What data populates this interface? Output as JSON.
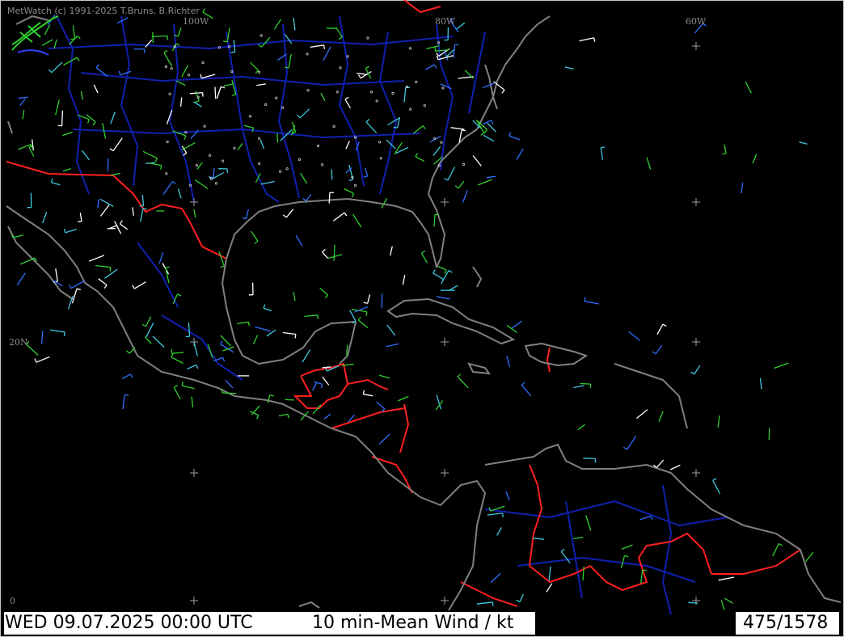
{
  "header": {
    "credit": "MetWatch  (c) 1991-2025 T.Bruns, B.Richter"
  },
  "grid_labels": {
    "lon_100w": "100W",
    "lon_80w": "80W",
    "lon_60w": "60W",
    "lat_20n": "20N",
    "lat_0": "0"
  },
  "footer": {
    "datetime": "WED 09.07.2025 00:00 UTC",
    "product": "10 min-Mean Wind / kt",
    "station_count": "475/1578"
  },
  "colors": {
    "background": "#000000",
    "coastline": "#808080",
    "borders": "#ff2020",
    "rivers_states": "#1020b0",
    "wind_green": "#30d030",
    "wind_cyan": "#40c8e0",
    "wind_blue": "#3070ff",
    "wind_white": "#ffffff",
    "grid_cross": "#a0a0a0",
    "label": "#8c8c8c"
  },
  "icons": {
    "logo": "metwatch-wave-logo-icon"
  }
}
